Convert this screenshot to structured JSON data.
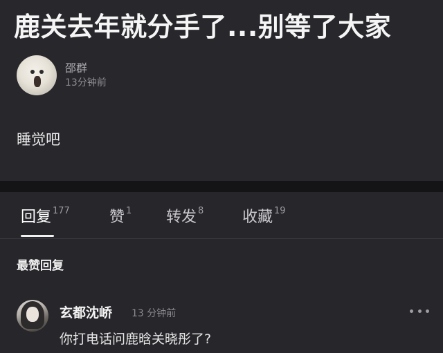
{
  "post": {
    "title": "鹿关去年就分手了...别等了大家",
    "author_name": "邵群",
    "time": "13分钟前",
    "body": "睡觉吧"
  },
  "tabs": [
    {
      "label": "回复",
      "count": "177"
    },
    {
      "label": "赞",
      "count": "1"
    },
    {
      "label": "转发",
      "count": "8"
    },
    {
      "label": "收藏",
      "count": "19"
    }
  ],
  "section": {
    "title": "最赞回复"
  },
  "comment": {
    "author": "玄都沈峤",
    "time": "13 分钟前",
    "text": "你打电话问鹿晗关晓彤了?"
  },
  "icons": {
    "more": "more-dots-icon"
  }
}
